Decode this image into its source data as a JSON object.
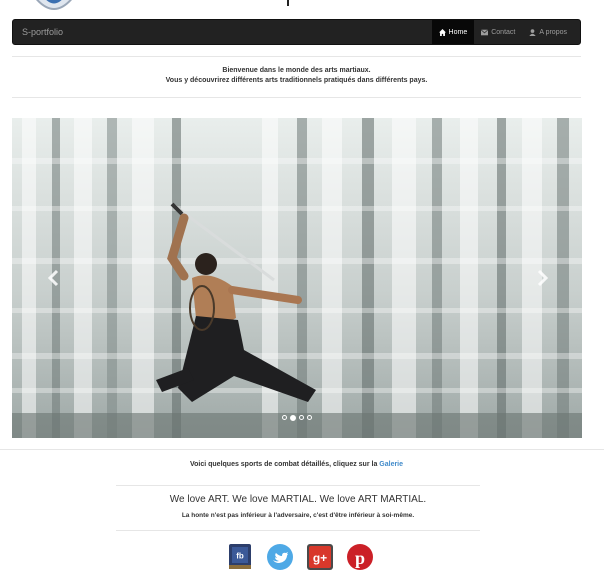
{
  "navbar": {
    "brand": "S-portfolio",
    "items": [
      {
        "label": "Home",
        "icon": "home-icon",
        "active": true
      },
      {
        "label": "Contact",
        "icon": "envelope-icon",
        "active": false
      },
      {
        "label": "A propos",
        "icon": "user-icon",
        "active": false
      }
    ]
  },
  "welcome": {
    "line1": "Bienvenue dans le monde des arts martiaux.",
    "line2": "Vous y découvrirez différents arts traditionnels pratiqués dans différents pays."
  },
  "carousel": {
    "slide_count": 4,
    "active_index": 1
  },
  "section": {
    "text": "Voici quelques sports de combat détaillés, cliquez sur la ",
    "link": "Galerie"
  },
  "motto": {
    "main": "We love ART. We love MARTIAL. We love ART MARTIAL.",
    "sub": "La honte n'est pas inférieur à l'adversaire, c'est d'être inférieur à soi-même."
  },
  "social": [
    {
      "name": "facebook-icon",
      "label": "fb",
      "color": "#3b5998"
    },
    {
      "name": "twitter-icon",
      "color": "#4ea9e6"
    },
    {
      "name": "google-plus-icon",
      "label": "g+",
      "color": "#d8382b"
    },
    {
      "name": "pinterest-icon",
      "label": "p",
      "color": "#cb2027"
    }
  ],
  "colors": {
    "navbar_bg": "#222222",
    "link": "#428bca"
  }
}
